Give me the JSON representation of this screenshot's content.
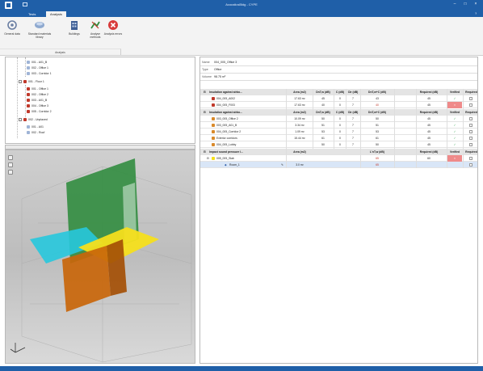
{
  "window": {
    "title": "AcousticsBldg - CYPE"
  },
  "tabs": [
    {
      "label": "Tests"
    },
    {
      "label": "Analysis"
    }
  ],
  "ribbon": {
    "buttons": [
      {
        "label": "General data"
      },
      {
        "label": "Standard materials library"
      },
      {
        "label": "Buildings"
      },
      {
        "label": "Analyse methods"
      },
      {
        "label": "Analysis errors"
      }
    ],
    "group_label": "Analysis"
  },
  "tree": [
    {
      "label": "001 - A01_B"
    },
    {
      "label": "002 - Office 1"
    },
    {
      "label": "003 - Corridor 1"
    },
    {
      "label": "001 - Floor 1"
    },
    {
      "label": "001 - Office 1"
    },
    {
      "label": "002 - Office 2"
    },
    {
      "label": "003 - A01_B"
    },
    {
      "label": "004 - Office 3"
    },
    {
      "label": "005 - Corridor 2"
    },
    {
      "label": "002 - Unplaced"
    },
    {
      "label": "001 - A01"
    },
    {
      "label": "002 - Roof"
    }
  ],
  "details": {
    "name_label": "Name",
    "name_value": "004_005_Office 3",
    "type_label": "Type",
    "type_value": "Office",
    "volume_label": "Volume",
    "volume_value": "98.75 m³"
  },
  "grid": {
    "groups": [
      {
        "title": "Insulation against airbo...",
        "headers": [
          "Area (m2)",
          "DnT,w (dB)",
          "C (dB)",
          "Ctr (dB)",
          "DnT,w+C (dB)",
          "Required (dB)",
          "Verified",
          "Required"
        ],
        "rows": [
          {
            "label": "004_005_A002",
            "area": "17.63 m²",
            "dntw": "45",
            "c": "0",
            "ctr": "7",
            "sum": "43",
            "req": "45",
            "verified": "✓",
            "fail": false
          },
          {
            "label": "004_005_F003",
            "area": "17.63 m²",
            "dntw": "40",
            "c": "0",
            "ctr": "7",
            "sum": "40",
            "req": "45",
            "verified": "×",
            "fail": true
          }
        ]
      },
      {
        "title": "Insulation against airbo...",
        "headers": [
          "Area (m2)",
          "DnT,w (dB)",
          "C (dB)",
          "Ctr (dB)",
          "DnT,w+C (dB)",
          "Required (dB)",
          "Verified",
          "Required"
        ],
        "rows": [
          {
            "label": "003_005_Office 2",
            "area": "10.09 m²",
            "dntw": "50",
            "c": "0",
            "ctr": "7",
            "sum": "50",
            "req": "45",
            "verified": "✓",
            "fail": false
          },
          {
            "label": "003_005_A01_B",
            "area": "3.34 m²",
            "dntw": "51",
            "c": "0",
            "ctr": "7",
            "sum": "51",
            "req": "45",
            "verified": "✓",
            "fail": false
          },
          {
            "label": "004_005_Corridor 2",
            "area": "1.09 m²",
            "dntw": "53",
            "c": "0",
            "ctr": "7",
            "sum": "53",
            "req": "45",
            "verified": "✓",
            "fail": false
          },
          {
            "label": "Exterior corridors",
            "area": "15.44 m²",
            "dntw": "61",
            "c": "0",
            "ctr": "7",
            "sum": "61",
            "req": "45",
            "verified": "✓",
            "fail": false
          },
          {
            "label": "004_005_Lobby",
            "area": "",
            "dntw": "50",
            "c": "0",
            "ctr": "7",
            "sum": "50",
            "req": "45",
            "verified": "✓",
            "fail": false
          }
        ]
      },
      {
        "title": "Impact sound pressure l...",
        "headers": [
          "Area (m2)",
          "L'nT,w (dB)",
          "Required (dB)",
          "Verified",
          "Required"
        ],
        "rows": [
          {
            "label": "005_005_Slab",
            "area": "",
            "sum": "65",
            "req": "60",
            "verified": "×",
            "fail": true
          },
          {
            "label": "Room_1",
            "area": "3.0 m²",
            "sum": "65",
            "req": "",
            "verified": "",
            "fail": false,
            "selected": true
          }
        ]
      }
    ]
  }
}
